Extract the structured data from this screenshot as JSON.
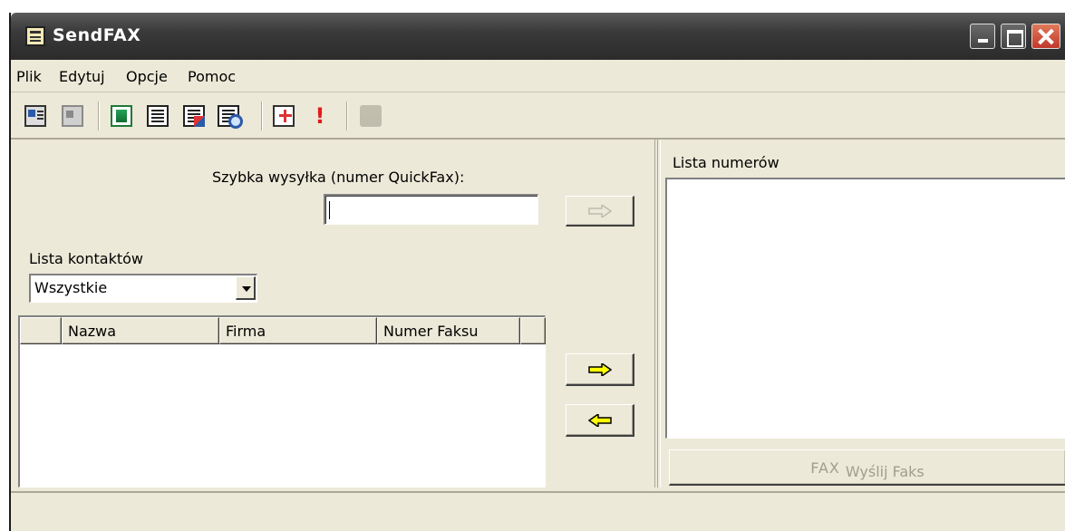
{
  "window": {
    "title": "SendFAX"
  },
  "menu": [
    "Plik",
    "Edytuj",
    "Opcje",
    "Pomoc"
  ],
  "quickfax": {
    "label": "Szybka wysyłka (numer QuickFax):",
    "value": ""
  },
  "contacts": {
    "label": "Lista kontaktów",
    "filter_value": "Wszystkie",
    "columns": [
      "",
      "Nazwa",
      "Firma",
      "Numer Faksu",
      ""
    ],
    "rows": []
  },
  "numbers": {
    "label": "Lista numerów",
    "items": []
  },
  "send_button": {
    "tag": "FAX",
    "label": "Wyślij Faks"
  },
  "colors": {
    "arrow_active": "#ffff00",
    "arrow_disabled": "#c0c0c0",
    "title_bg": "#3a3a3a",
    "face": "#ece9d8",
    "close": "#d0482d"
  }
}
